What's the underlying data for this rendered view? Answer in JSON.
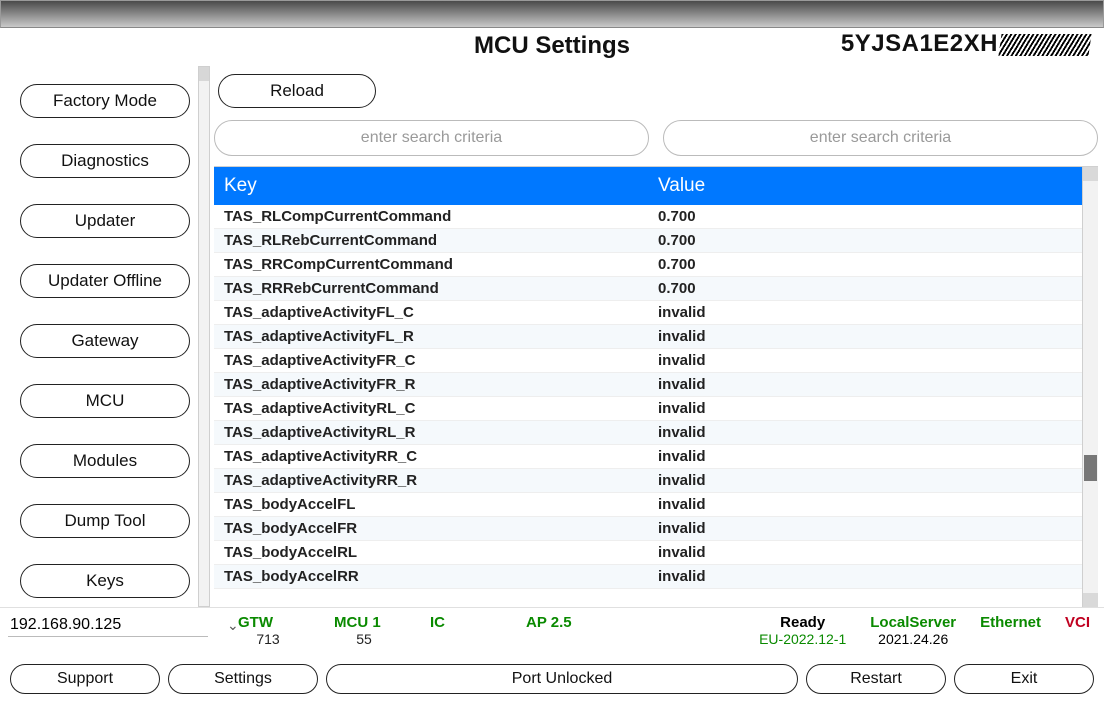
{
  "header": {
    "title": "MCU Settings",
    "vin_prefix": "5YJSA1E2XH"
  },
  "sidebar": {
    "items": [
      "Factory Mode",
      "Diagnostics",
      "Updater",
      "Updater Offline",
      "Gateway",
      "MCU",
      "Modules",
      "Dump Tool",
      "Keys"
    ]
  },
  "actions": {
    "reload": "Reload"
  },
  "search": {
    "key_placeholder": "enter search criteria",
    "value_placeholder": "enter search criteria"
  },
  "table": {
    "col_key": "Key",
    "col_value": "Value",
    "rows": [
      {
        "k": "TAS_RLCompCurrentCommand",
        "v": "0.700"
      },
      {
        "k": "TAS_RLRebCurrentCommand",
        "v": "0.700"
      },
      {
        "k": "TAS_RRCompCurrentCommand",
        "v": "0.700"
      },
      {
        "k": "TAS_RRRebCurrentCommand",
        "v": "0.700"
      },
      {
        "k": "TAS_adaptiveActivityFL_C",
        "v": "invalid"
      },
      {
        "k": "TAS_adaptiveActivityFL_R",
        "v": "invalid"
      },
      {
        "k": "TAS_adaptiveActivityFR_C",
        "v": "invalid"
      },
      {
        "k": "TAS_adaptiveActivityFR_R",
        "v": "invalid"
      },
      {
        "k": "TAS_adaptiveActivityRL_C",
        "v": "invalid"
      },
      {
        "k": "TAS_adaptiveActivityRL_R",
        "v": "invalid"
      },
      {
        "k": "TAS_adaptiveActivityRR_C",
        "v": "invalid"
      },
      {
        "k": "TAS_adaptiveActivityRR_R",
        "v": "invalid"
      },
      {
        "k": "TAS_bodyAccelFL",
        "v": "invalid"
      },
      {
        "k": "TAS_bodyAccelFR",
        "v": "invalid"
      },
      {
        "k": "TAS_bodyAccelRL",
        "v": "invalid"
      },
      {
        "k": "TAS_bodyAccelRR",
        "v": "invalid"
      }
    ]
  },
  "status": {
    "ip": "192.168.90.125",
    "mods": [
      {
        "name": "GTW",
        "sub": "713"
      },
      {
        "name": "MCU 1",
        "sub": "55"
      },
      {
        "name": "IC",
        "sub": ""
      },
      {
        "name": "AP 2.5",
        "sub": ""
      }
    ],
    "ready": {
      "t": "Ready",
      "s": "EU-2022.12-1"
    },
    "server": {
      "t": "LocalServer",
      "s": "2021.24.26"
    },
    "eth": {
      "t": "Ethernet",
      "s": ""
    },
    "vci": {
      "t": "VCI",
      "s": ""
    }
  },
  "footer": {
    "support": "Support",
    "settings": "Settings",
    "port": "Port Unlocked",
    "restart": "Restart",
    "exit": "Exit"
  }
}
